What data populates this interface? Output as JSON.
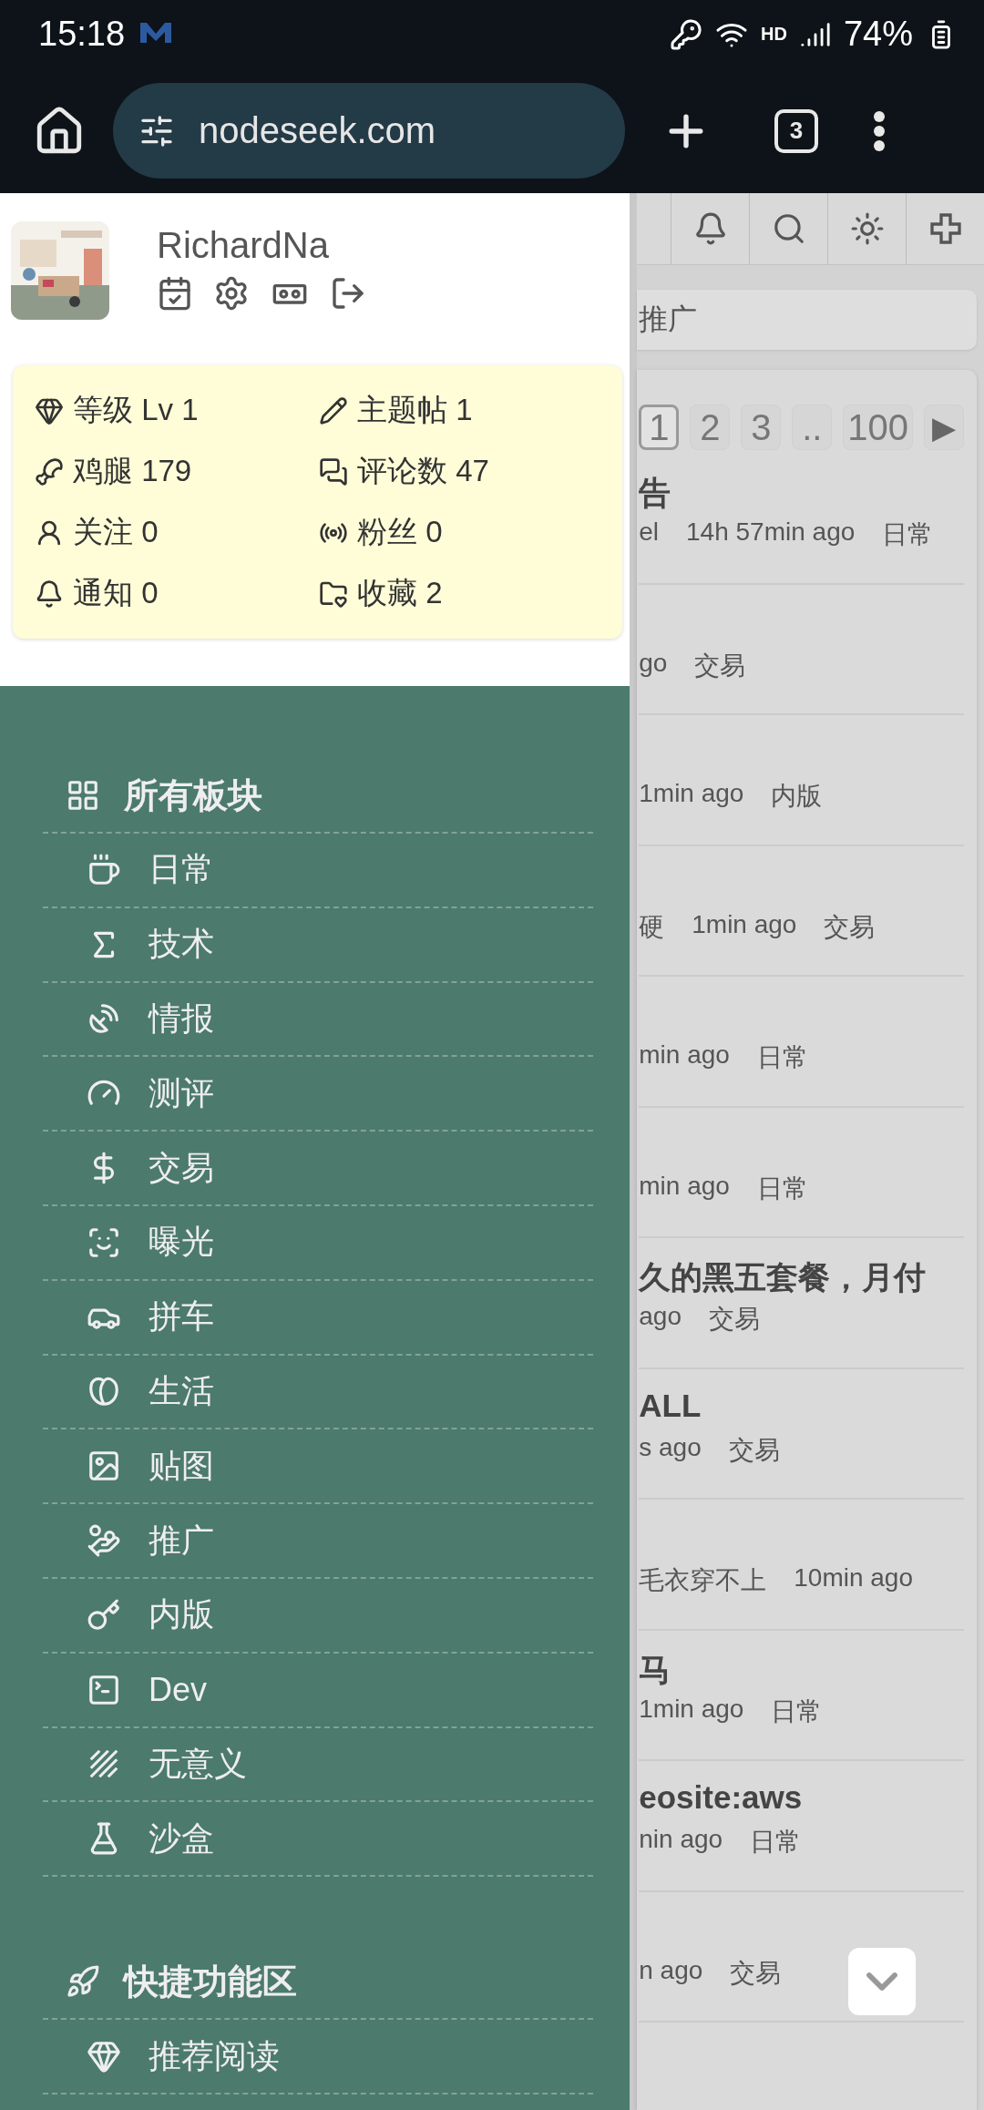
{
  "status_bar": {
    "time": "15:18",
    "network": "HD",
    "battery": "74%"
  },
  "browser": {
    "url": "nodeseek.com",
    "tab_count": "3"
  },
  "profile": {
    "username": "RichardNa",
    "stats": [
      {
        "label": "等级 Lv 1"
      },
      {
        "label": "主题帖 1"
      },
      {
        "label": "鸡腿 179"
      },
      {
        "label": "评论数 47"
      },
      {
        "label": "关注 0"
      },
      {
        "label": "粉丝 0"
      },
      {
        "label": "通知 0"
      },
      {
        "label": "收藏 2"
      }
    ]
  },
  "sidebar": {
    "sections": [
      {
        "title": "所有板块",
        "items": [
          "日常",
          "技术",
          "情报",
          "测评",
          "交易",
          "曝光",
          "拼车",
          "生活",
          "贴图",
          "推广",
          "内版",
          "Dev",
          "无意义",
          "沙盒"
        ]
      },
      {
        "title": "快捷功能区",
        "items": [
          "推荐阅读"
        ]
      }
    ]
  },
  "page": {
    "search_text": "推广",
    "pagination": [
      {
        "label": "1",
        "selected": true
      },
      {
        "label": "2",
        "selected": false
      },
      {
        "label": "3",
        "selected": false
      },
      {
        "label": "..",
        "selected": false
      },
      {
        "label": "100",
        "selected": false
      }
    ],
    "next": "▶",
    "posts": [
      {
        "title": "告",
        "meta": [
          "el",
          "14h 57min ago",
          "日常"
        ]
      },
      {
        "meta": [
          "go",
          "交易"
        ]
      },
      {
        "meta": [
          "1min ago",
          "内版"
        ]
      },
      {
        "meta": [
          "硬",
          "1min ago",
          "交易"
        ]
      },
      {
        "meta": [
          "min ago",
          "日常"
        ]
      },
      {
        "meta": [
          "min ago",
          "日常"
        ]
      },
      {
        "title": "久的黑五套餐，月付",
        "meta": [
          "ago",
          "交易"
        ]
      },
      {
        "title": "ALL",
        "meta": [
          "s ago",
          "交易"
        ]
      },
      {
        "meta": [
          "毛衣穿不上",
          "10min ago"
        ]
      },
      {
        "title": "马",
        "meta": [
          "1min ago",
          "日常"
        ]
      },
      {
        "title": "eosite:aws",
        "meta": [
          "nin ago",
          "日常"
        ]
      },
      {
        "meta": [
          "n ago",
          "交易"
        ]
      }
    ]
  }
}
